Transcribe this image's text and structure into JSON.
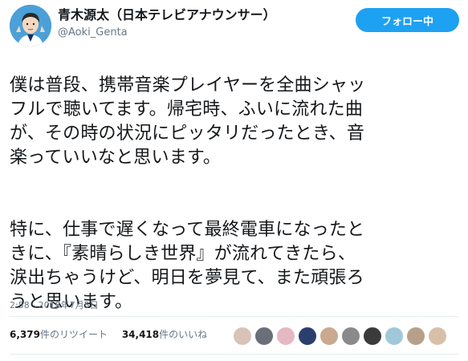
{
  "author": {
    "display_name": "青木源太（日本テレビアナウンサー）",
    "handle": "@Aoki_Genta",
    "avatar_icon": "avatar-portrait-icon"
  },
  "follow_button": {
    "label": "フォロー中"
  },
  "tweet": {
    "paragraph1": "僕は普段、携帯音楽プレイヤーを全曲シャッ\nフルで聴いてます。帰宅時、ふいに流れた曲\nが、その時の状況にピッタリだったとき、音\n楽っていいなと思います。",
    "paragraph2": "特に、仕事で遅くなって最終電車になったと\nきに、『素晴らしき世界』が流れてきたら、\n涙出ちゃうけど、明日を夢見て、また頑張ろ\nうと思います。",
    "timestamp": "2:58 - 2018年7月5日"
  },
  "stats": {
    "retweets_count": "6,379",
    "retweets_label": "件のリツイート",
    "likes_count": "34,418",
    "likes_label": "件のいいね"
  },
  "likers": [
    "#d9c2b8",
    "#6b6f7a",
    "#e6b8c4",
    "#2b3f6e",
    "#c9a98f",
    "#8a8a8a",
    "#3b3b3b",
    "#a0c8d8",
    "#b7a08a",
    "#d8c0a8"
  ],
  "colors": {
    "accent": "#1da1f2",
    "text": "#14171a",
    "muted": "#657786"
  }
}
